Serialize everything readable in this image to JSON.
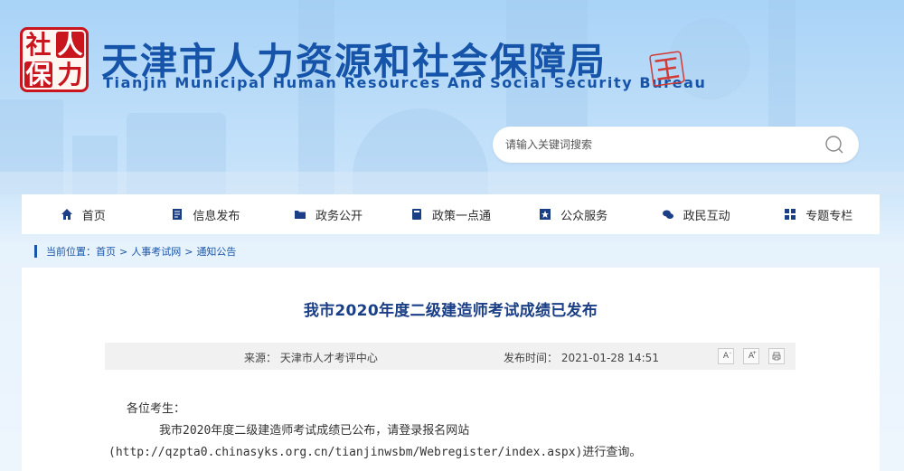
{
  "header": {
    "logo_chars": [
      "社",
      "人",
      "保",
      "力"
    ],
    "title": "天津市人力资源和社会保障局",
    "subtitle": "Tianjin Municipal Human Resources And Social Security Bureau",
    "stamp_text": "天津",
    "search": {
      "placeholder": "请输入关键词搜索",
      "icon": "search-icon"
    }
  },
  "nav": {
    "items": [
      {
        "label": "首页",
        "icon": "home-icon"
      },
      {
        "label": "信息发布",
        "icon": "document-icon"
      },
      {
        "label": "政务公开",
        "icon": "folder-icon"
      },
      {
        "label": "政策一点通",
        "icon": "book-icon"
      },
      {
        "label": "公众服务",
        "icon": "star-icon"
      },
      {
        "label": "政民互动",
        "icon": "chat-icon"
      },
      {
        "label": "专题专栏",
        "icon": "grid-icon"
      }
    ]
  },
  "breadcrumb": {
    "prefix": "当前位置：",
    "items": [
      "首页",
      "人事考试网",
      "通知公告"
    ],
    "separator": ">"
  },
  "article": {
    "title": "我市2020年度二级建造师考试成绩已发布",
    "source": "来源：  天津市人才考评中心",
    "publish_time": "发布时间：  2021-01-28 14:51",
    "tools": {
      "font_decrease": "A",
      "font_increase": "A",
      "print": "print-icon"
    },
    "body": {
      "greeting": "各位考生：",
      "line1": "我市2020年度二级建造师考试成绩已公布，请登录报名网站",
      "line2": "(http://qzpta0.chinasyks.org.cn/tianjinwsbm/Webregister/index.aspx)进行查询。"
    }
  },
  "colors": {
    "brand_blue": "#1554a8",
    "seal_red": "#c9151e",
    "title_blue": "#1a3f86"
  }
}
